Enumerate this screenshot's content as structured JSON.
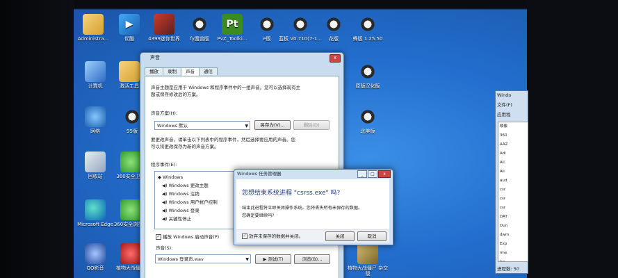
{
  "desktop": {
    "icons": [
      {
        "label": "Administra...",
        "glyph": "",
        "style": "g-folder"
      },
      {
        "label": "优酷",
        "glyph": "▶",
        "style": "g-blue"
      },
      {
        "label": "4399迷你世界",
        "glyph": "",
        "style": "g-game"
      },
      {
        "label": "fy魔兽版",
        "glyph": "",
        "style": "g-flower"
      },
      {
        "label": "PvZ_Toolki...",
        "glyph": "Pt",
        "style": "g-pvz"
      },
      {
        "label": "e版",
        "glyph": "",
        "style": "g-flower"
      },
      {
        "label": "蓝板 V0.710(7-1...",
        "glyph": "",
        "style": "g-flower"
      },
      {
        "label": "花版",
        "glyph": "",
        "style": "g-flower"
      },
      {
        "label": "蜂版 1.25.50",
        "glyph": "",
        "style": "g-flower"
      },
      {
        "label": "计算机",
        "glyph": "",
        "style": "g-pc"
      },
      {
        "label": "激活工具",
        "glyph": "",
        "style": "g-folder"
      },
      {
        "label": "原版汉化版",
        "glyph": "",
        "style": "g-flower"
      },
      {
        "label": "网络",
        "glyph": "",
        "style": "g-net"
      },
      {
        "label": "95版",
        "glyph": "",
        "style": "g-flower"
      },
      {
        "label": "北美版",
        "glyph": "",
        "style": "g-flower"
      },
      {
        "label": "回收站",
        "glyph": "",
        "style": "g-trash"
      },
      {
        "label": "360安全卫士",
        "glyph": "",
        "style": "g-green"
      },
      {
        "label": "Microsoft Edge",
        "glyph": "",
        "style": "g-edge"
      },
      {
        "label": "360安全浏览器",
        "glyph": "",
        "style": "g-green"
      },
      {
        "label": "QQ影音",
        "glyph": "",
        "style": "g-qq"
      },
      {
        "label": "植物大战僵尸",
        "glyph": "",
        "style": "g-red"
      },
      {
        "label": "植物大战僵尸 杂交版",
        "glyph": "",
        "style": "g-plant"
      }
    ]
  },
  "sound_dialog": {
    "title": "声音",
    "close": "x",
    "tabs": [
      "播放",
      "录制",
      "声音",
      "通信"
    ],
    "intro_1": "声音主题是应用于 Windows 和程序事件中的一组声音。您可以选择现有主",
    "intro_2": "题或保存修改后的方案。",
    "scheme_label": "声音方案(H):",
    "scheme_value": "Windows 默认",
    "save_as_button": "另存为(V)...",
    "delete_button": "删除(D)",
    "change_1": "要更改声音，请单击以下列表中的程序事件，然后选择要应用的声音。您",
    "change_2": "可以将更改保存为新的声音方案。",
    "events_label": "程序事件(E):",
    "events": [
      "Windows",
      "Windows 更改主题",
      "Windows 注销",
      "Windows 用户帐户控制",
      "Windows 登录",
      "关键性停止"
    ],
    "startup_checkbox": "播放 Windows 启动声音(P)",
    "sound_label": "声音(S):",
    "sound_value": "Windows 登录声.wav",
    "test_button": "▶ 测试(T)",
    "browse_button": "浏览(B)..."
  },
  "task_manager_dialog": {
    "title": "Windows 任务管理器",
    "question": "您想结束系统进程 \"csrss.exe\" 吗?",
    "info_1": "结束此进程将立即关闭操作系统。您将丢失所有未保存的数据。",
    "info_2": "您确定要继续吗?",
    "abandon_checkbox": "放弃未保存的数据并关闭。",
    "shutdown_button": "关闭",
    "cancel_button": "取消"
  },
  "right_window": {
    "title": "Windo",
    "menu": "文件(F)",
    "tab": "应用程",
    "column": "映像",
    "rows": [
      "360",
      "AAZ",
      "Adi",
      "Ali",
      "Ali",
      "aud",
      "csr",
      "csr",
      "csr",
      "DAT",
      "Dun",
      "dwm",
      "Exp",
      "ime",
      "lsa",
      "lsm",
      "Met"
    ],
    "status": "进程数: 50"
  }
}
